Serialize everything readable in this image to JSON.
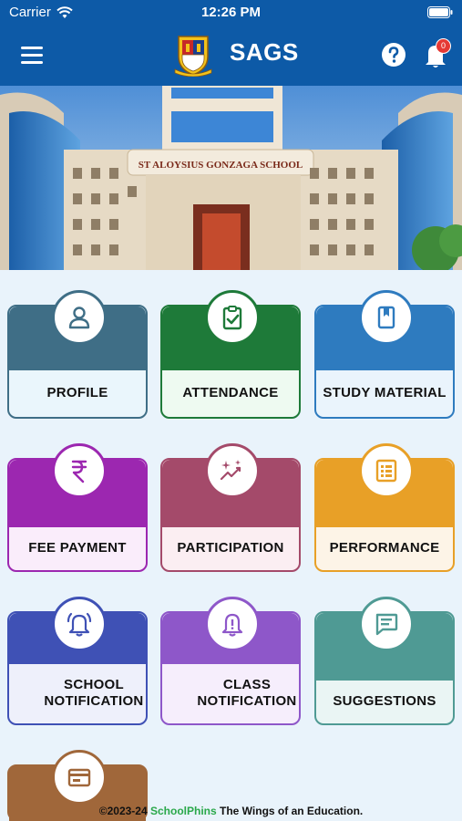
{
  "status_bar": {
    "carrier": "Carrier",
    "time": "12:26 PM"
  },
  "header": {
    "title": "SAGS",
    "notification_count": "0"
  },
  "banner": {
    "sign_text": "ST ALOYSIUS GONZAGA SCHOOL"
  },
  "tiles": [
    {
      "label": "PROFILE",
      "icon": "person-icon",
      "color": "#3f6e86"
    },
    {
      "label": "ATTENDANCE",
      "icon": "clipboard-check-icon",
      "color": "#1e7a39"
    },
    {
      "label": "STUDY MATERIAL",
      "icon": "book-icon",
      "color": "#2e7bbf"
    },
    {
      "label": "FEE PAYMENT",
      "icon": "rupee-icon",
      "color": "#9c27b0"
    },
    {
      "label": "PARTICIPATION",
      "icon": "sparkle-icon",
      "color": "#a44a6a"
    },
    {
      "label": "PERFORMANCE",
      "icon": "list-icon",
      "color": "#e8a027"
    },
    {
      "label": "SCHOOL NOTIFICATION",
      "icon": "bell-ring-icon",
      "color": "#3f51b5"
    },
    {
      "label": "CLASS NOTIFICATION",
      "icon": "bell-alert-icon",
      "color": "#8e57c9"
    },
    {
      "label": "SUGGESTIONS",
      "icon": "chat-icon",
      "color": "#4f9a94"
    },
    {
      "label": "",
      "icon": "card-icon",
      "color": "#a0673a"
    }
  ],
  "footer": {
    "copyright": "©2023-24",
    "brand": "SchoolPhins",
    "tagline": "The Wings of an Education."
  }
}
